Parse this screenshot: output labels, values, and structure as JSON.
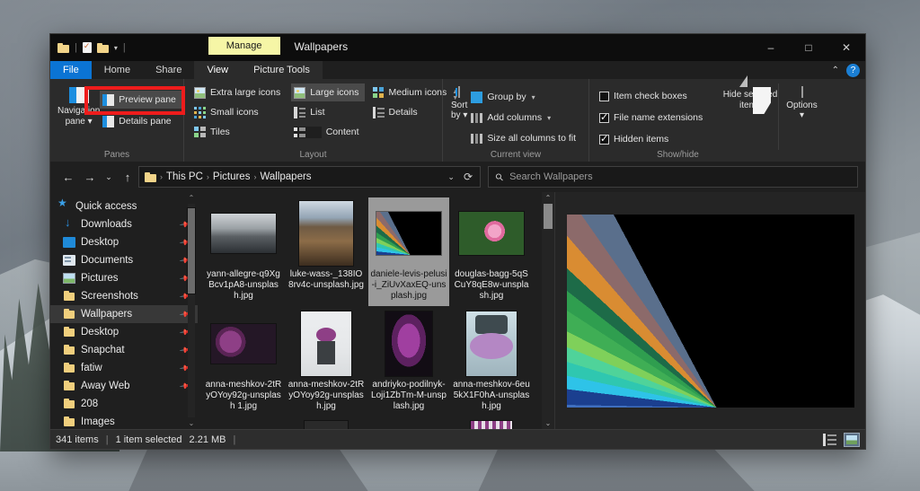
{
  "desktop": {
    "wallpaper_description": "snowy-mountain-landscape"
  },
  "window": {
    "title": "Wallpapers",
    "quick_access_toolbar": [
      {
        "name": "folder-icon",
        "label": ""
      },
      {
        "name": "properties-icon",
        "label": ""
      },
      {
        "name": "new-folder-icon",
        "label": ""
      },
      {
        "name": "customize-qat-caret",
        "label": "▾"
      }
    ],
    "contextual_tool_group": "Manage",
    "controls": {
      "minimize": "─",
      "maximize": "☐",
      "close": "✕",
      "collapse_ribbon": "⌃",
      "help": "?"
    }
  },
  "tabs": [
    {
      "label": "File",
      "state": "file"
    },
    {
      "label": "Home",
      "state": "normal"
    },
    {
      "label": "Share",
      "state": "normal"
    },
    {
      "label": "View",
      "state": "active"
    },
    {
      "label": "Picture Tools",
      "state": "contextual"
    }
  ],
  "ribbon": {
    "groups": [
      {
        "name": "panes",
        "label": "Panes",
        "big_button": {
          "label_line1": "Navigation",
          "label_line2": "pane ▾",
          "icon": "navigation-pane-icon"
        },
        "small_buttons": [
          {
            "label": "Preview pane",
            "icon": "preview-pane-icon",
            "highlighted": true
          },
          {
            "label": "Details pane",
            "icon": "details-pane-icon",
            "highlighted": false
          }
        ]
      },
      {
        "name": "layout",
        "label": "Layout",
        "items": [
          {
            "label": "Extra large icons",
            "icon": "extra-large-icons-icon",
            "selected": false
          },
          {
            "label": "Large icons",
            "icon": "large-icons-icon",
            "selected": true
          },
          {
            "label": "Medium icons",
            "icon": "medium-icons-icon",
            "selected": false
          },
          {
            "label": "Small icons",
            "icon": "small-icons-icon",
            "selected": false
          },
          {
            "label": "List",
            "icon": "list-view-icon",
            "selected": false
          },
          {
            "label": "Details",
            "icon": "details-view-icon",
            "selected": false
          },
          {
            "label": "Tiles",
            "icon": "tiles-view-icon",
            "selected": false
          },
          {
            "label": "Content",
            "icon": "content-view-icon",
            "selected": false
          }
        ]
      },
      {
        "name": "current-view",
        "label": "Current view",
        "big_button": {
          "label_line1": "Sort",
          "label_line2": "by ▾",
          "icon": "sort-by-icon"
        },
        "small_buttons": [
          {
            "label": "Group by",
            "icon": "group-by-icon",
            "dropdown": "▾"
          },
          {
            "label": "Add columns",
            "icon": "add-columns-icon",
            "dropdown": "▾"
          },
          {
            "label": "Size all columns to fit",
            "icon": "size-columns-icon",
            "dropdown": ""
          }
        ]
      },
      {
        "name": "show-hide",
        "label": "Show/hide",
        "checkboxes": [
          {
            "label": "Item check boxes",
            "checked": false
          },
          {
            "label": "File name extensions",
            "checked": true
          },
          {
            "label": "Hidden items",
            "checked": true
          }
        ],
        "big_buttons": [
          {
            "label_line1": "Hide selected",
            "label_line2": "items",
            "icon": "hide-selected-items-icon"
          },
          {
            "label_line1": "Options",
            "label_line2": "▾",
            "icon": "options-icon"
          }
        ]
      }
    ]
  },
  "navbar": {
    "back": "←",
    "forward": "→",
    "recent": "⌄",
    "up": "↑",
    "breadcrumbs": [
      "This PC",
      "Pictures",
      "Wallpapers"
    ],
    "breadcrumb_separator": "›",
    "dropdown_caret": "⌄",
    "refresh": "⟳",
    "search": {
      "placeholder": "Search Wallpapers",
      "value": "",
      "icon": "search-icon"
    }
  },
  "sidebar": {
    "items": [
      {
        "label": "Quick access",
        "icon": "star-icon",
        "pinned": false,
        "selected": false,
        "root": true
      },
      {
        "label": "Downloads",
        "icon": "downloads-icon",
        "pinned": true,
        "selected": false
      },
      {
        "label": "Desktop",
        "icon": "desktop-icon",
        "pinned": true,
        "selected": false
      },
      {
        "label": "Documents",
        "icon": "documents-icon",
        "pinned": true,
        "selected": false
      },
      {
        "label": "Pictures",
        "icon": "pictures-icon",
        "pinned": true,
        "selected": false
      },
      {
        "label": "Screenshots",
        "icon": "folder-icon",
        "pinned": true,
        "selected": false
      },
      {
        "label": "Wallpapers",
        "icon": "folder-icon",
        "pinned": true,
        "selected": true
      },
      {
        "label": "Desktop",
        "icon": "folder-icon",
        "pinned": true,
        "selected": false
      },
      {
        "label": "Snapchat",
        "icon": "folder-icon",
        "pinned": true,
        "selected": false
      },
      {
        "label": "fatiw",
        "icon": "folder-icon",
        "pinned": true,
        "selected": false
      },
      {
        "label": "Away Web",
        "icon": "folder-icon",
        "pinned": true,
        "selected": false
      },
      {
        "label": "208",
        "icon": "folder-icon",
        "pinned": false,
        "selected": false
      },
      {
        "label": "Images",
        "icon": "folder-icon",
        "pinned": false,
        "selected": false
      }
    ],
    "scroll_up": "⌃",
    "scroll_down": "⌄"
  },
  "files": [
    {
      "name": "yann-allegre-q9XgBcv1pA8-unsplash.jpg",
      "selected": false,
      "thumb": "mountain-bw"
    },
    {
      "name": "luke-wass-_138IO8rv4c-unsplash.jpg",
      "selected": false,
      "thumb": "desert-rocks"
    },
    {
      "name": "daniele-levis-pelusi-i_ZiUvXaxEQ-unsplash.jpg",
      "selected": true,
      "thumb": "color-fan"
    },
    {
      "name": "douglas-bagg-5qSCuY8qE8w-unsplash.jpg",
      "selected": false,
      "thumb": "pink-flower"
    },
    {
      "name": "anna-meshkov-2tRyOYoy92g-unsplash 1.jpg",
      "selected": false,
      "thumb": "purple-flowers-wide"
    },
    {
      "name": "anna-meshkov-2tRyOYoy92g-unsplash.jpg",
      "selected": false,
      "thumb": "purple-vase"
    },
    {
      "name": "andriyko-podilnyk-Loji1ZbTm-M-unsplash.jpg",
      "selected": false,
      "thumb": "purple-blooms-dark"
    },
    {
      "name": "anna-meshkov-6eu5kX1F0hA-unsplash.jpg",
      "selected": false,
      "thumb": "lilac-bowl"
    }
  ],
  "filepane": {
    "scroll_up": "⌃",
    "scroll_down": "⌄"
  },
  "preview": {
    "image_description": "colorful-paper-fan-radial",
    "for_file": "daniele-levis-pelusi-i_ZiUvXaxEQ-unsplash.jpg"
  },
  "statusbar": {
    "item_count": "341 items",
    "separator": "|",
    "selection": "1 item selected",
    "size": "2.21 MB",
    "trailing_separator": "|",
    "view_buttons": [
      {
        "name": "details-view-button",
        "label": ""
      },
      {
        "name": "large-icons-view-button",
        "label": ""
      }
    ]
  },
  "colors": {
    "window_bg": "#1f1f1f",
    "ribbon_bg": "#2b2b2b",
    "title_bg": "#0d0d0d",
    "file_tab_accent": "#0b74d4",
    "manage_highlight": "#f6f6a6",
    "selection_bg": "#9a9a9a",
    "sidebar_selected": "#383838",
    "annotation_red": "#ee1c1c",
    "help_blue": "#1b7fd4"
  }
}
